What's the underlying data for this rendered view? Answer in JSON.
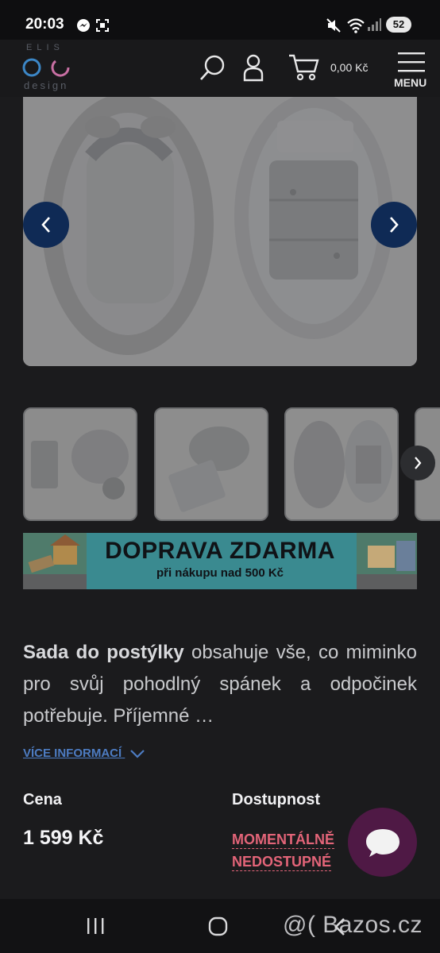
{
  "status_bar": {
    "time": "20:03",
    "battery": "52"
  },
  "header": {
    "logo_letters": "ELIS",
    "logo_sub": "design",
    "cart_total": "0,00 Kč",
    "menu_label": "MENU"
  },
  "banner": {
    "title": "DOPRAVA ZDARMA",
    "subtitle": "při nákupu nad 500 Kč"
  },
  "description": {
    "bold": "Sada do postýlky",
    "text": " obsahuje vše, co miminko pro svůj pohodlný spánek a odpočinek potřebuje. Příjemné …"
  },
  "more_link": "VÍCE INFORMACÍ",
  "price": {
    "label": "Cena",
    "value": "1 599 Kč"
  },
  "availability": {
    "label": "Dostupnost",
    "line1": "MOMENTÁLNĚ",
    "line2": "NEDOSTUPNÉ"
  },
  "watermark": "@( Bazos.cz",
  "icons": [
    "messenger-icon",
    "screenshot-icon",
    "mute-icon",
    "wifi-icon",
    "signal-icon",
    "search-icon",
    "user-icon",
    "cart-icon",
    "menu-icon",
    "prev-arrow-icon",
    "next-arrow-icon",
    "chat-icon",
    "recent-apps-icon",
    "home-icon",
    "back-icon"
  ],
  "colors": {
    "accent": "#0f2a55",
    "unavailable": "#e26478",
    "chat": "#4f1945",
    "link": "#4d7cc2"
  }
}
